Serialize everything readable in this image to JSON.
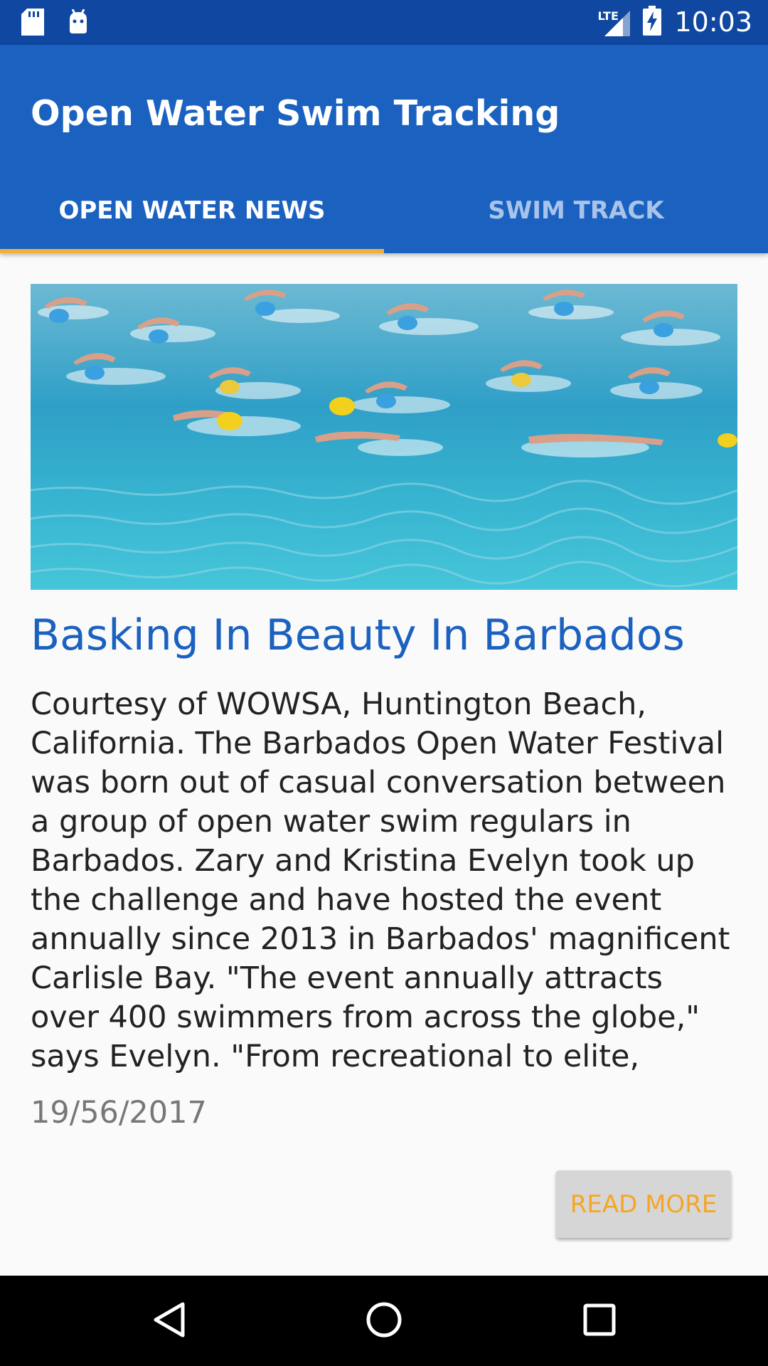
{
  "status_bar": {
    "time": "10:03",
    "network": "LTE",
    "icons": [
      "sd-card-icon",
      "android-icon",
      "signal-icon",
      "battery-charging-icon"
    ]
  },
  "app": {
    "title": "Open Water Swim Tracking"
  },
  "tabs": [
    {
      "label": "OPEN WATER NEWS",
      "selected": true
    },
    {
      "label": "SWIM TRACK",
      "selected": false
    }
  ],
  "article": {
    "image": "open-water-swimmers-photo",
    "headline": "Basking In Beauty In Barbados",
    "summary": "Courtesy of WOWSA, Huntington Beach, California. The Barbados Open Water Festival was born out of casual conversation between a group of open water swim regulars in Barbados. Zary and Kristina Evelyn took up the challenge and have hosted the event annually since 2013 in Barbados' magnificent Carlisle Bay. \"The event annually attracts over 400 swimmers from across the globe,\" says Evelyn. \"From recreational to elite, young to th…",
    "date": "19/56/2017",
    "read_more_label": "READ MORE"
  },
  "nav": {
    "icons": [
      "back-icon",
      "home-icon",
      "recents-icon"
    ]
  },
  "colors": {
    "status_bar": "#0f47a1",
    "primary": "#1b62c0",
    "accent": "#f5a623",
    "tab_indicator": "#f2b134"
  }
}
